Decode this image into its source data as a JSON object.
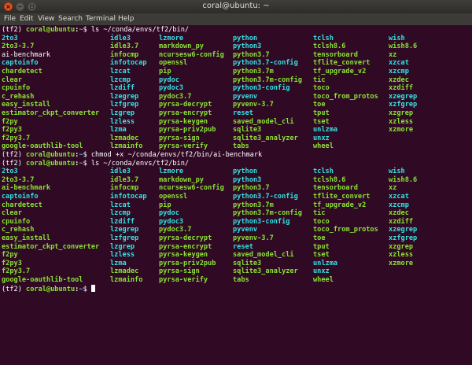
{
  "window": {
    "title": "coral@ubuntu: ~"
  },
  "menubar": {
    "items": [
      "File",
      "Edit",
      "View",
      "Search",
      "Terminal",
      "Help"
    ]
  },
  "colors": {
    "background": "#300a24",
    "prompt_user": "#8ae234",
    "prompt_path": "#729fcf",
    "executable": "#8ae234",
    "symlink": "#34e2e2",
    "plain": "#ffffff"
  },
  "terminal": {
    "lines": [
      {
        "kind": "prompt",
        "env": "(tf2) ",
        "user": "coral@ubuntu",
        "path": "~",
        "symbol": "$ ",
        "command": "ls ~/conda/envs/tf2/bin/"
      },
      {
        "kind": "files",
        "items": [
          {
            "name": "2to3",
            "type": "link"
          },
          {
            "name": "idle3",
            "type": "link"
          },
          {
            "name": "lzmore",
            "type": "link"
          },
          {
            "name": "python",
            "type": "link"
          },
          {
            "name": "tclsh",
            "type": "link"
          },
          {
            "name": "wish",
            "type": "link"
          }
        ]
      },
      {
        "kind": "files",
        "items": [
          {
            "name": "2to3-3.7",
            "type": "exec"
          },
          {
            "name": "idle3.7",
            "type": "exec"
          },
          {
            "name": "markdown_py",
            "type": "exec"
          },
          {
            "name": "python3",
            "type": "link"
          },
          {
            "name": "tclsh8.6",
            "type": "exec"
          },
          {
            "name": "wish8.6",
            "type": "exec"
          }
        ]
      },
      {
        "kind": "files",
        "items": [
          {
            "name": "ai-benchmark",
            "type": "plain"
          },
          {
            "name": "infocmp",
            "type": "exec"
          },
          {
            "name": "ncursesw6-config",
            "type": "exec"
          },
          {
            "name": "python3.7",
            "type": "exec"
          },
          {
            "name": "tensorboard",
            "type": "exec"
          },
          {
            "name": "xz",
            "type": "exec"
          }
        ]
      },
      {
        "kind": "files",
        "items": [
          {
            "name": "captoinfo",
            "type": "link"
          },
          {
            "name": "infotocap",
            "type": "link"
          },
          {
            "name": "openssl",
            "type": "exec"
          },
          {
            "name": "python3.7-config",
            "type": "link"
          },
          {
            "name": "tflite_convert",
            "type": "exec"
          },
          {
            "name": "xzcat",
            "type": "link"
          }
        ]
      },
      {
        "kind": "files",
        "items": [
          {
            "name": "chardetect",
            "type": "exec"
          },
          {
            "name": "lzcat",
            "type": "link"
          },
          {
            "name": "pip",
            "type": "exec"
          },
          {
            "name": "python3.7m",
            "type": "exec"
          },
          {
            "name": "tf_upgrade_v2",
            "type": "exec"
          },
          {
            "name": "xzcmp",
            "type": "link"
          }
        ]
      },
      {
        "kind": "files",
        "items": [
          {
            "name": "clear",
            "type": "exec"
          },
          {
            "name": "lzcmp",
            "type": "link"
          },
          {
            "name": "pydoc",
            "type": "link"
          },
          {
            "name": "python3.7m-config",
            "type": "exec"
          },
          {
            "name": "tic",
            "type": "exec"
          },
          {
            "name": "xzdec",
            "type": "exec"
          }
        ]
      },
      {
        "kind": "files",
        "items": [
          {
            "name": "cpuinfo",
            "type": "exec"
          },
          {
            "name": "lzdiff",
            "type": "link"
          },
          {
            "name": "pydoc3",
            "type": "link"
          },
          {
            "name": "python3-config",
            "type": "link"
          },
          {
            "name": "toco",
            "type": "exec"
          },
          {
            "name": "xzdiff",
            "type": "exec"
          }
        ]
      },
      {
        "kind": "files",
        "items": [
          {
            "name": "c_rehash",
            "type": "exec"
          },
          {
            "name": "lzegrep",
            "type": "link"
          },
          {
            "name": "pydoc3.7",
            "type": "exec"
          },
          {
            "name": "pyvenv",
            "type": "link"
          },
          {
            "name": "toco_from_protos",
            "type": "exec"
          },
          {
            "name": "xzegrep",
            "type": "link"
          }
        ]
      },
      {
        "kind": "files",
        "items": [
          {
            "name": "easy_install",
            "type": "exec"
          },
          {
            "name": "lzfgrep",
            "type": "link"
          },
          {
            "name": "pyrsa-decrypt",
            "type": "exec"
          },
          {
            "name": "pyvenv-3.7",
            "type": "exec"
          },
          {
            "name": "toe",
            "type": "exec"
          },
          {
            "name": "xzfgrep",
            "type": "link"
          }
        ]
      },
      {
        "kind": "files",
        "items": [
          {
            "name": "estimator_ckpt_converter",
            "type": "exec"
          },
          {
            "name": "lzgrep",
            "type": "link"
          },
          {
            "name": "pyrsa-encrypt",
            "type": "exec"
          },
          {
            "name": "reset",
            "type": "link"
          },
          {
            "name": "tput",
            "type": "exec"
          },
          {
            "name": "xzgrep",
            "type": "exec"
          }
        ]
      },
      {
        "kind": "files",
        "items": [
          {
            "name": "f2py",
            "type": "exec"
          },
          {
            "name": "lzless",
            "type": "link"
          },
          {
            "name": "pyrsa-keygen",
            "type": "exec"
          },
          {
            "name": "saved_model_cli",
            "type": "exec"
          },
          {
            "name": "tset",
            "type": "exec"
          },
          {
            "name": "xzless",
            "type": "exec"
          }
        ]
      },
      {
        "kind": "files",
        "items": [
          {
            "name": "f2py3",
            "type": "exec"
          },
          {
            "name": "lzma",
            "type": "link"
          },
          {
            "name": "pyrsa-priv2pub",
            "type": "exec"
          },
          {
            "name": "sqlite3",
            "type": "exec"
          },
          {
            "name": "unlzma",
            "type": "link"
          },
          {
            "name": "xzmore",
            "type": "exec"
          }
        ]
      },
      {
        "kind": "files",
        "items": [
          {
            "name": "f2py3.7",
            "type": "exec"
          },
          {
            "name": "lzmadec",
            "type": "exec"
          },
          {
            "name": "pyrsa-sign",
            "type": "exec"
          },
          {
            "name": "sqlite3_analyzer",
            "type": "exec"
          },
          {
            "name": "unxz",
            "type": "link"
          },
          {
            "name": "",
            "type": "plain"
          }
        ]
      },
      {
        "kind": "files",
        "items": [
          {
            "name": "google-oauthlib-tool",
            "type": "exec"
          },
          {
            "name": "lzmainfo",
            "type": "exec"
          },
          {
            "name": "pyrsa-verify",
            "type": "exec"
          },
          {
            "name": "tabs",
            "type": "exec"
          },
          {
            "name": "wheel",
            "type": "exec"
          },
          {
            "name": "",
            "type": "plain"
          }
        ]
      },
      {
        "kind": "prompt",
        "env": "(tf2) ",
        "user": "coral@ubuntu",
        "path": "~",
        "symbol": "$ ",
        "command": "chmod +x ~/conda/envs/tf2/bin/ai-benchmark"
      },
      {
        "kind": "prompt",
        "env": "(tf2) ",
        "user": "coral@ubuntu",
        "path": "~",
        "symbol": "$ ",
        "command": "ls ~/conda/envs/tf2/bin/"
      },
      {
        "kind": "files",
        "items": [
          {
            "name": "2to3",
            "type": "link"
          },
          {
            "name": "idle3",
            "type": "link"
          },
          {
            "name": "lzmore",
            "type": "link"
          },
          {
            "name": "python",
            "type": "link"
          },
          {
            "name": "tclsh",
            "type": "link"
          },
          {
            "name": "wish",
            "type": "link"
          }
        ]
      },
      {
        "kind": "files",
        "items": [
          {
            "name": "2to3-3.7",
            "type": "exec"
          },
          {
            "name": "idle3.7",
            "type": "exec"
          },
          {
            "name": "markdown_py",
            "type": "exec"
          },
          {
            "name": "python3",
            "type": "link"
          },
          {
            "name": "tclsh8.6",
            "type": "exec"
          },
          {
            "name": "wish8.6",
            "type": "exec"
          }
        ]
      },
      {
        "kind": "files",
        "items": [
          {
            "name": "ai-benchmark",
            "type": "exec"
          },
          {
            "name": "infocmp",
            "type": "exec"
          },
          {
            "name": "ncursesw6-config",
            "type": "exec"
          },
          {
            "name": "python3.7",
            "type": "exec"
          },
          {
            "name": "tensorboard",
            "type": "exec"
          },
          {
            "name": "xz",
            "type": "exec"
          }
        ]
      },
      {
        "kind": "files",
        "items": [
          {
            "name": "captoinfo",
            "type": "link"
          },
          {
            "name": "infotocap",
            "type": "link"
          },
          {
            "name": "openssl",
            "type": "exec"
          },
          {
            "name": "python3.7-config",
            "type": "link"
          },
          {
            "name": "tflite_convert",
            "type": "exec"
          },
          {
            "name": "xzcat",
            "type": "link"
          }
        ]
      },
      {
        "kind": "files",
        "items": [
          {
            "name": "chardetect",
            "type": "exec"
          },
          {
            "name": "lzcat",
            "type": "link"
          },
          {
            "name": "pip",
            "type": "exec"
          },
          {
            "name": "python3.7m",
            "type": "exec"
          },
          {
            "name": "tf_upgrade_v2",
            "type": "exec"
          },
          {
            "name": "xzcmp",
            "type": "link"
          }
        ]
      },
      {
        "kind": "files",
        "items": [
          {
            "name": "clear",
            "type": "exec"
          },
          {
            "name": "lzcmp",
            "type": "link"
          },
          {
            "name": "pydoc",
            "type": "link"
          },
          {
            "name": "python3.7m-config",
            "type": "exec"
          },
          {
            "name": "tic",
            "type": "exec"
          },
          {
            "name": "xzdec",
            "type": "exec"
          }
        ]
      },
      {
        "kind": "files",
        "items": [
          {
            "name": "cpuinfo",
            "type": "exec"
          },
          {
            "name": "lzdiff",
            "type": "link"
          },
          {
            "name": "pydoc3",
            "type": "link"
          },
          {
            "name": "python3-config",
            "type": "link"
          },
          {
            "name": "toco",
            "type": "exec"
          },
          {
            "name": "xzdiff",
            "type": "exec"
          }
        ]
      },
      {
        "kind": "files",
        "items": [
          {
            "name": "c_rehash",
            "type": "exec"
          },
          {
            "name": "lzegrep",
            "type": "link"
          },
          {
            "name": "pydoc3.7",
            "type": "exec"
          },
          {
            "name": "pyvenv",
            "type": "link"
          },
          {
            "name": "toco_from_protos",
            "type": "exec"
          },
          {
            "name": "xzegrep",
            "type": "link"
          }
        ]
      },
      {
        "kind": "files",
        "items": [
          {
            "name": "easy_install",
            "type": "exec"
          },
          {
            "name": "lzfgrep",
            "type": "link"
          },
          {
            "name": "pyrsa-decrypt",
            "type": "exec"
          },
          {
            "name": "pyvenv-3.7",
            "type": "exec"
          },
          {
            "name": "toe",
            "type": "exec"
          },
          {
            "name": "xzfgrep",
            "type": "link"
          }
        ]
      },
      {
        "kind": "files",
        "items": [
          {
            "name": "estimator_ckpt_converter",
            "type": "exec"
          },
          {
            "name": "lzgrep",
            "type": "link"
          },
          {
            "name": "pyrsa-encrypt",
            "type": "exec"
          },
          {
            "name": "reset",
            "type": "link"
          },
          {
            "name": "tput",
            "type": "exec"
          },
          {
            "name": "xzgrep",
            "type": "exec"
          }
        ]
      },
      {
        "kind": "files",
        "items": [
          {
            "name": "f2py",
            "type": "exec"
          },
          {
            "name": "lzless",
            "type": "link"
          },
          {
            "name": "pyrsa-keygen",
            "type": "exec"
          },
          {
            "name": "saved_model_cli",
            "type": "exec"
          },
          {
            "name": "tset",
            "type": "exec"
          },
          {
            "name": "xzless",
            "type": "exec"
          }
        ]
      },
      {
        "kind": "files",
        "items": [
          {
            "name": "f2py3",
            "type": "exec"
          },
          {
            "name": "lzma",
            "type": "link"
          },
          {
            "name": "pyrsa-priv2pub",
            "type": "exec"
          },
          {
            "name": "sqlite3",
            "type": "exec"
          },
          {
            "name": "unlzma",
            "type": "link"
          },
          {
            "name": "xzmore",
            "type": "exec"
          }
        ]
      },
      {
        "kind": "files",
        "items": [
          {
            "name": "f2py3.7",
            "type": "exec"
          },
          {
            "name": "lzmadec",
            "type": "exec"
          },
          {
            "name": "pyrsa-sign",
            "type": "exec"
          },
          {
            "name": "sqlite3_analyzer",
            "type": "exec"
          },
          {
            "name": "unxz",
            "type": "link"
          },
          {
            "name": "",
            "type": "plain"
          }
        ]
      },
      {
        "kind": "files",
        "items": [
          {
            "name": "google-oauthlib-tool",
            "type": "exec"
          },
          {
            "name": "lzmainfo",
            "type": "exec"
          },
          {
            "name": "pyrsa-verify",
            "type": "exec"
          },
          {
            "name": "tabs",
            "type": "exec"
          },
          {
            "name": "wheel",
            "type": "exec"
          },
          {
            "name": "",
            "type": "plain"
          }
        ]
      },
      {
        "kind": "prompt",
        "env": "(tf2) ",
        "user": "coral@ubuntu",
        "path": "~",
        "symbol": "$ ",
        "command": "",
        "cursor": true
      }
    ]
  }
}
